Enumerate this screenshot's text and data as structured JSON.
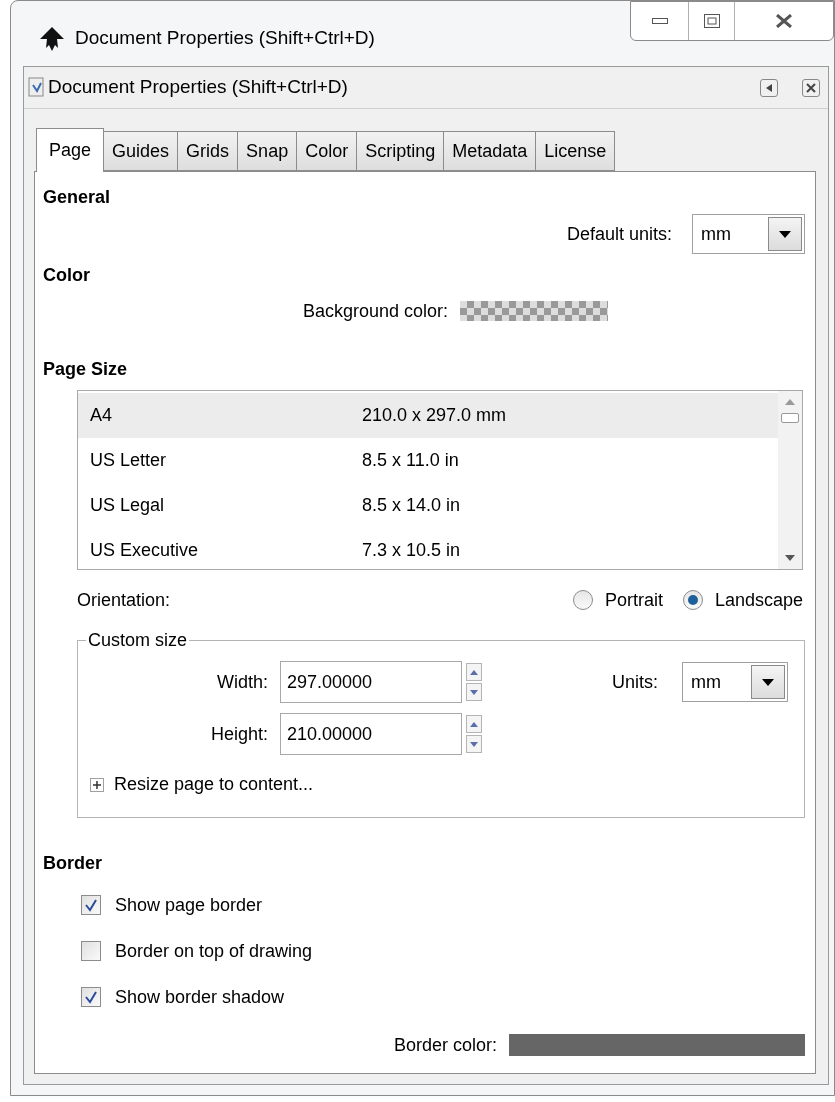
{
  "window": {
    "title": "Document Properties (Shift+Ctrl+D)"
  },
  "panel": {
    "title": "Document Properties (Shift+Ctrl+D)"
  },
  "tabs": [
    {
      "label": "Page",
      "selected": true
    },
    {
      "label": "Guides",
      "selected": false
    },
    {
      "label": "Grids",
      "selected": false
    },
    {
      "label": "Snap",
      "selected": false
    },
    {
      "label": "Color",
      "selected": false
    },
    {
      "label": "Scripting",
      "selected": false
    },
    {
      "label": "Metadata",
      "selected": false
    },
    {
      "label": "License",
      "selected": false
    }
  ],
  "general": {
    "heading": "General",
    "default_units": {
      "label": "Default units:",
      "value": "mm"
    }
  },
  "color": {
    "heading": "Color",
    "background_color": {
      "label": "Background color:"
    }
  },
  "page_size": {
    "heading": "Page Size",
    "sizes": [
      {
        "name": "A4",
        "dimensions": "210.0 x 297.0 mm",
        "selected": true
      },
      {
        "name": "US Letter",
        "dimensions": "8.5 x 11.0 in",
        "selected": false
      },
      {
        "name": "US Legal",
        "dimensions": "8.5 x 14.0 in",
        "selected": false
      },
      {
        "name": "US Executive",
        "dimensions": "7.3 x 10.5 in",
        "selected": false
      }
    ],
    "orientation": {
      "label": "Orientation:",
      "options": [
        {
          "label": "Portrait",
          "selected": false
        },
        {
          "label": "Landscape",
          "selected": true
        }
      ]
    },
    "custom_size": {
      "legend": "Custom size",
      "width": {
        "label": "Width:",
        "value": "297.00000"
      },
      "height": {
        "label": "Height:",
        "value": "210.00000"
      },
      "units": {
        "label": "Units:",
        "value": "mm"
      },
      "resize": {
        "label": "Resize page to content...",
        "expanded": false
      }
    }
  },
  "border": {
    "heading": "Border",
    "options": [
      {
        "label": "Show page border",
        "checked": true
      },
      {
        "label": "Border on top of drawing",
        "checked": false
      },
      {
        "label": "Show border shadow",
        "checked": true
      }
    ],
    "border_color": {
      "label": "Border color:"
    }
  }
}
